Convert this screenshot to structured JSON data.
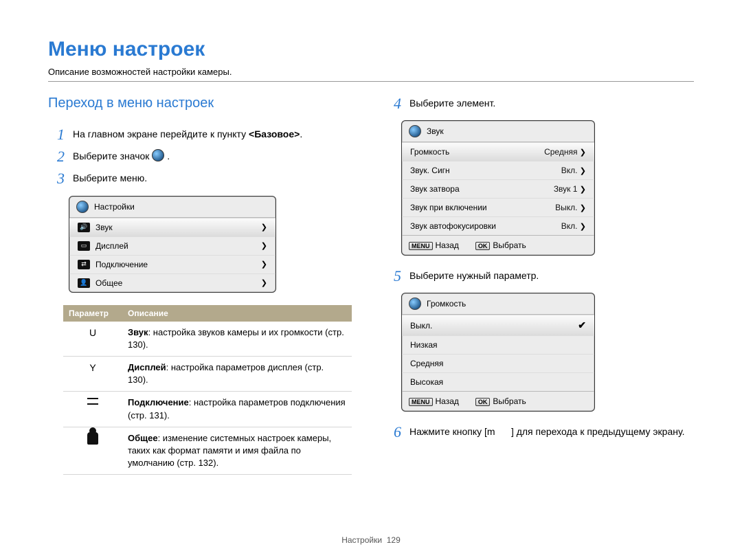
{
  "page": {
    "title": "Меню настроек",
    "subtitle": "Описание возможностей настройки камеры.",
    "footer_label": "Настройки",
    "footer_page": "129"
  },
  "left": {
    "section_title": "Переход в меню настроек",
    "steps": {
      "1": {
        "num": "1",
        "text_before": "На главном экране перейдите к пункту ",
        "bold": "<Базовое>",
        "text_after": "."
      },
      "2": {
        "num": "2",
        "text_before": "Выберите значок ",
        "text_after": " ."
      },
      "3": {
        "num": "3",
        "text": "Выберите меню."
      }
    },
    "camera": {
      "title": "Настройки",
      "items": [
        {
          "icon": "sound",
          "label": "Звук"
        },
        {
          "icon": "display",
          "label": "Дисплей"
        },
        {
          "icon": "conn",
          "label": "Подключение"
        },
        {
          "icon": "general",
          "label": "Общее"
        }
      ]
    },
    "table": {
      "headers": {
        "param": "Параметр",
        "desc": "Описание"
      },
      "rows": [
        {
          "param": "U",
          "bold": "Звук",
          "text": ": настройка звуков камеры и их громкости (стр. 130)."
        },
        {
          "param": "Y",
          "bold": "Дисплей",
          "text": ": настройка параметров дисплея (стр. 130)."
        },
        {
          "param": "conn-icon",
          "bold": "Подключение",
          "text": ": настройка параметров подключения (стр. 131)."
        },
        {
          "param": "general-icon",
          "bold": "Общее",
          "text": ": изменение системных настроек камеры, таких как формат памяти и имя файла по умолчанию (стр. 132)."
        }
      ]
    }
  },
  "right": {
    "steps": {
      "4": {
        "num": "4",
        "text": "Выберите элемент."
      },
      "5": {
        "num": "5",
        "text": "Выберите нужный параметр."
      },
      "6": {
        "num": "6",
        "text_before": "Нажмите кнопку [m",
        "text_after": "] для перехода к предыдущему экрану."
      }
    },
    "camera_sound": {
      "title": "Звук",
      "rows": [
        {
          "label": "Громкость",
          "value": "Средняя",
          "selected": true
        },
        {
          "label": "Звук. Сигн",
          "value": "Вкл."
        },
        {
          "label": "Звук затвора",
          "value": "Звук 1"
        },
        {
          "label": "Звук при включении",
          "value": "Выкл."
        },
        {
          "label": "Звук автофокусировки",
          "value": "Вкл."
        }
      ],
      "back": "Назад",
      "select": "Выбрать",
      "back_badge": "MENU",
      "select_badge": "OK"
    },
    "camera_volume": {
      "title": "Громкость",
      "rows": [
        {
          "label": "Выкл.",
          "selected": true
        },
        {
          "label": "Низкая"
        },
        {
          "label": "Средняя"
        },
        {
          "label": "Высокая"
        }
      ],
      "back": "Назад",
      "select": "Выбрать",
      "back_badge": "MENU",
      "select_badge": "OK"
    }
  }
}
